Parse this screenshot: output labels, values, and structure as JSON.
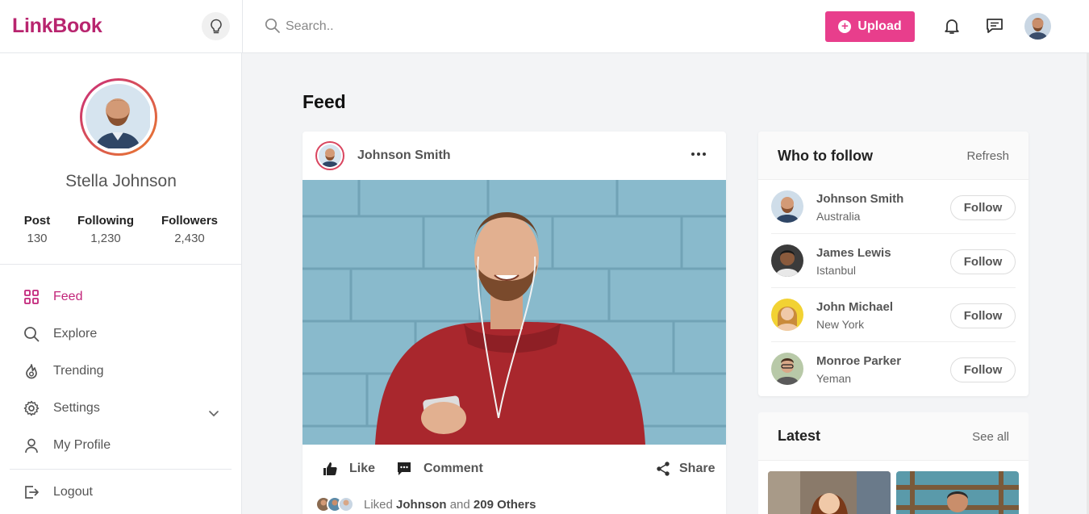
{
  "header": {
    "logo": "LinkBook",
    "search_placeholder": "Search..",
    "upload_label": "Upload",
    "colors": {
      "brand": "#b8256f",
      "accent": "#e83e8c"
    }
  },
  "profile": {
    "name": "Stella Johnson",
    "stats": [
      {
        "label": "Post",
        "value": "130"
      },
      {
        "label": "Following",
        "value": "1,230"
      },
      {
        "label": "Followers",
        "value": "2,430"
      }
    ]
  },
  "nav": {
    "items": [
      {
        "label": "Feed",
        "icon": "grid-icon",
        "active": true
      },
      {
        "label": "Explore",
        "icon": "search-icon"
      },
      {
        "label": "Trending",
        "icon": "flame-icon"
      },
      {
        "label": "Settings",
        "icon": "gear-icon"
      },
      {
        "label": "My Profile",
        "icon": "user-icon"
      },
      {
        "label": "Logout",
        "icon": "logout-icon"
      }
    ]
  },
  "feed": {
    "title": "Feed",
    "post": {
      "author": "Johnson Smith",
      "actions": {
        "like": "Like",
        "comment": "Comment",
        "share": "Share"
      },
      "liked_prefix": "Liked",
      "liked_name": "Johnson",
      "liked_and": "and",
      "liked_others": "209 Others"
    }
  },
  "who_to_follow": {
    "title": "Who to follow",
    "refresh": "Refresh",
    "follow_label": "Follow",
    "people": [
      {
        "name": "Johnson Smith",
        "location": "Australia"
      },
      {
        "name": "James Lewis",
        "location": "Istanbul"
      },
      {
        "name": "John Michael",
        "location": "New York"
      },
      {
        "name": "Monroe Parker",
        "location": "Yeman"
      }
    ]
  },
  "latest": {
    "title": "Latest",
    "see_all": "See all"
  }
}
